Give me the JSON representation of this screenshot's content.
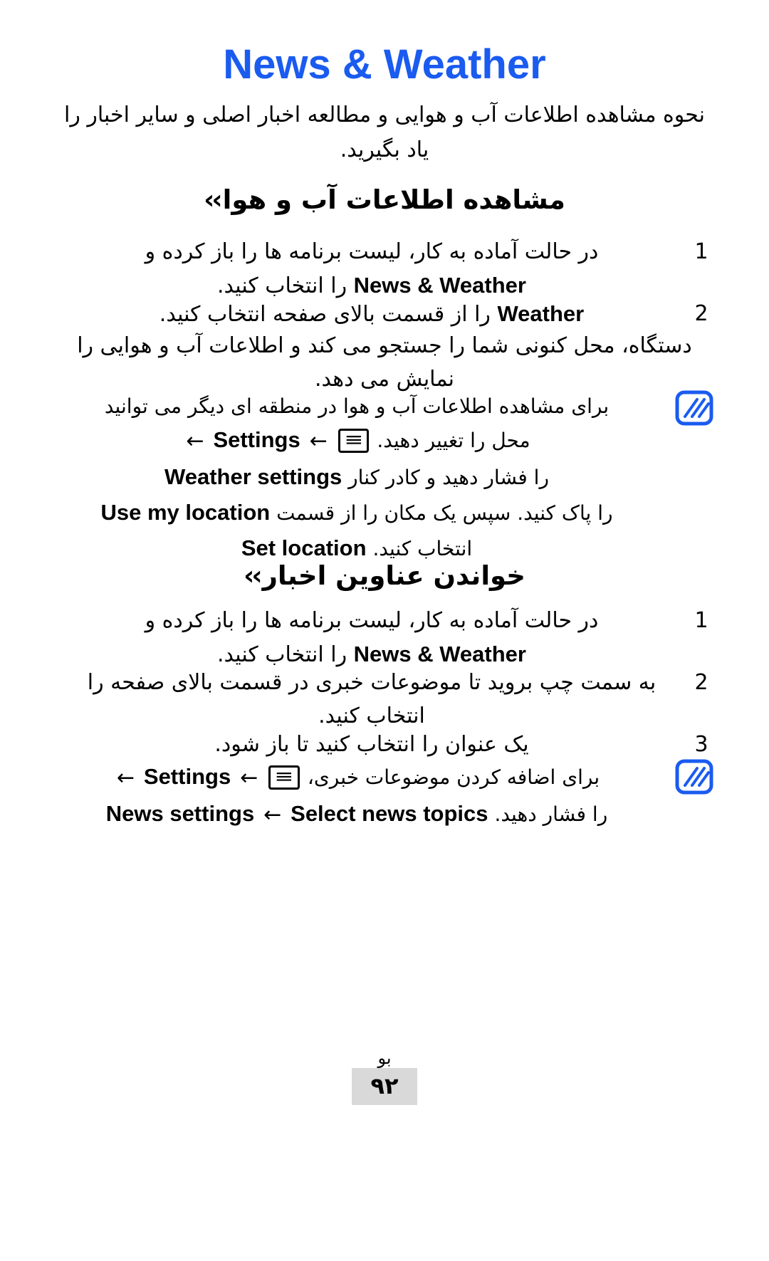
{
  "document": {
    "title": "News & Weather",
    "title_color": "#1a5bf0",
    "intro": "نحوه مشاهده اطلاعات آب و هوایی و مطالعه اخبار اصلی و سایر اخبار را یاد بگیرید."
  },
  "sections": [
    {
      "id": "weather",
      "chevron": "››",
      "heading": "مشاهده اطلاعات آب و هوا",
      "steps": [
        {
          "number": "1",
          "line1": "در حالت آماده به کار، لیست برنامه ها را باز کرده و",
          "line2_pre": "",
          "latin": "News & Weather",
          "line2_post": "را انتخاب کنید."
        },
        {
          "number": "2",
          "latin": "Weather",
          "text": "را از قسمت بالای صفحه انتخاب کنید."
        }
      ],
      "paragraph": "دستگاه، محل کنونی شما را جستجو می کند و اطلاعات آب و هوایی را نمایش می دهد.",
      "note": {
        "icon": "note-icon",
        "line1": "برای مشاهده اطلاعات آب و هوا در منطقه ای دیگر می توانید",
        "line2_pre": "محل را تغییر دهید.",
        "menu_key": "≡",
        "arrow": "←",
        "settings": "Settings",
        "line3_latin": "Weather settings",
        "line3_post": "را فشار دهید و کادر کنار",
        "line4_latin": "Use my location",
        "line4_post": "را پاک کنید. سپس یک مکان را از قسمت",
        "line5_latin": "Set location",
        "line5_post": "انتخاب کنید."
      }
    },
    {
      "id": "news",
      "chevron": "››",
      "heading": "خواندن عناوین اخبار",
      "steps": [
        {
          "number": "1",
          "line1": "در حالت آماده به کار، لیست برنامه ها را باز کرده و",
          "latin": "News & Weather",
          "line2_post": "را انتخاب کنید."
        },
        {
          "number": "2",
          "line1": "به سمت چپ بروید تا موضوعات خبری در قسمت بالای صفحه را",
          "line2": "انتخاب کنید."
        },
        {
          "number": "3",
          "line1": "یک عنوان را انتخاب کنید تا باز شود."
        }
      ],
      "note": {
        "icon": "note-icon",
        "line1_pre": "برای اضافه کردن موضوعات خبری،",
        "menu_key": "≡",
        "arrow": "←",
        "settings": "Settings",
        "line2_latin_a": "News settings",
        "line2_arrow": "←",
        "line2_latin_b": "Select news topics",
        "line2_post": "را فشار دهید."
      }
    }
  ],
  "footer": {
    "label": "بو",
    "page_number": "۹۲"
  }
}
